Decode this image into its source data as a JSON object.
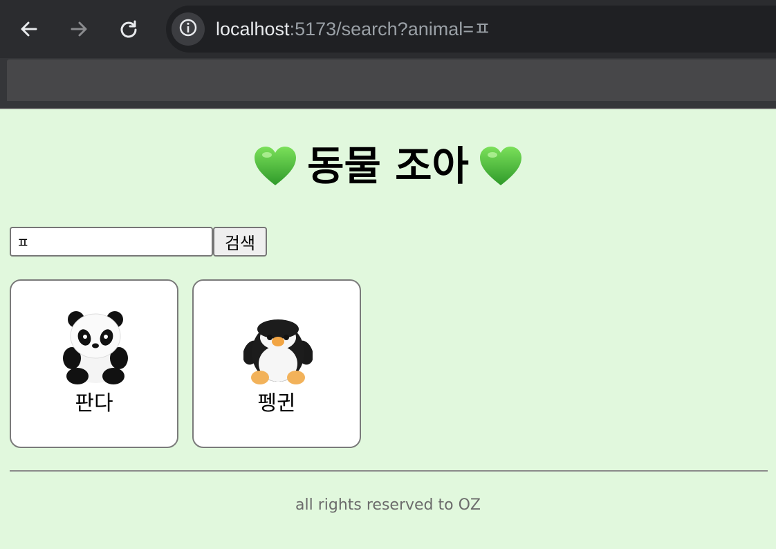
{
  "browser": {
    "url_host": "localhost",
    "url_rest": ":5173/search?animal=ㅍ",
    "icons": {
      "back": "arrow-left-icon",
      "forward": "arrow-right-icon",
      "reload": "reload-icon",
      "site_info": "info-icon"
    }
  },
  "page": {
    "title": "동물 조아",
    "heart_icon": "green-heart-icon",
    "heart_color": "#5ec93e",
    "background": "#e1f8dd"
  },
  "search": {
    "value": "ㅍ",
    "button_label": "검색"
  },
  "results": [
    {
      "label": "판다",
      "image": "panda-plush-image"
    },
    {
      "label": "펭귄",
      "image": "penguin-plush-image"
    }
  ],
  "footer": {
    "text": "all rights reserved to OZ"
  }
}
